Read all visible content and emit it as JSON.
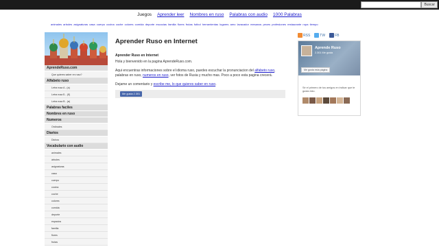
{
  "search": {
    "placeholder": "",
    "button_label": "Buscar"
  },
  "nav": {
    "items": [
      {
        "label": "Juegos",
        "link": false
      },
      {
        "label": "Aprender leer",
        "link": true
      },
      {
        "label": "Nombres en ruso",
        "link": true
      },
      {
        "label": "Palabras con audio",
        "link": true
      },
      {
        "label": "1000 Palabras",
        "link": true
      }
    ]
  },
  "categories": [
    "animales",
    "arboles",
    "asignaturas",
    "casa",
    "cuerpo",
    "cocina",
    "coche",
    "colores",
    "comida",
    "deporte",
    "escocias",
    "familia",
    "flores",
    "frutas",
    "futbol",
    "herramientas",
    "lugares",
    "aero",
    "lavacador",
    "mesanos",
    "peces",
    "profesiones",
    "restaurante",
    "ropa",
    "tiempo"
  ],
  "sidebar": {
    "items": [
      {
        "type": "head",
        "label": "AprendeRuso.com"
      },
      {
        "type": "sub",
        "label": "Que quieres saber en ruso?"
      },
      {
        "type": "head",
        "label": "Alfabeto ruso"
      },
      {
        "type": "sub",
        "label": "Letra rusa A - (a)"
      },
      {
        "type": "sub",
        "label": "Letra rusa Б - (б)"
      },
      {
        "type": "sub",
        "label": "Letra rusa В - (в)"
      },
      {
        "type": "head",
        "label": "Palabras faciles"
      },
      {
        "type": "head",
        "label": "Nombres en ruso"
      },
      {
        "type": "head",
        "label": "Numeros"
      },
      {
        "type": "sub",
        "label": "Ordinales"
      },
      {
        "type": "head",
        "label": "Diarios"
      },
      {
        "type": "sub",
        "label": "Dichos"
      },
      {
        "type": "head",
        "label": "Vocabulario con audio"
      },
      {
        "type": "sub",
        "label": "animales"
      },
      {
        "type": "sub",
        "label": "árboles"
      },
      {
        "type": "sub",
        "label": "asignaturas"
      },
      {
        "type": "sub",
        "label": "casa"
      },
      {
        "type": "sub",
        "label": "cuerpo"
      },
      {
        "type": "sub",
        "label": "cocina"
      },
      {
        "type": "sub",
        "label": "coche"
      },
      {
        "type": "sub",
        "label": "colores"
      },
      {
        "type": "sub",
        "label": "comida"
      },
      {
        "type": "sub",
        "label": "deporte"
      },
      {
        "type": "sub",
        "label": "espacios"
      },
      {
        "type": "sub",
        "label": "familia"
      },
      {
        "type": "sub",
        "label": "flores"
      },
      {
        "type": "sub",
        "label": "frutas"
      }
    ]
  },
  "main": {
    "title": "Aprender Ruso en Internet",
    "subtitle": "Aprender Ruso en Internet",
    "greeting": "Hola y bienvenido en la pagina AprendeRuso.com.",
    "para2_a": "Aqui encuentras informaciones sobre el idioma ruso, puedes escuchar la pronunciacion del ",
    "para2_link1": "alfabeto ruso",
    "para2_b": ", palabras en ruso, ",
    "para2_link2": "numeros en ruso",
    "para2_c": ", ver fotos de Rusia y mucho mas. Poco a poco esta pagina crecerá.",
    "para3_a": "Dejame un comentario y ",
    "para3_link": "escribe me, lo que quieres saber en ruso",
    "para3_b": ".",
    "like_button": "Me gusta 2.301"
  },
  "right": {
    "social": [
      {
        "label": "RSS",
        "color": "#f18b33"
      },
      {
        "label": "TW",
        "color": "#55acee"
      },
      {
        "label": "FB",
        "color": "#3b5998"
      }
    ],
    "fb": {
      "name": "Aprende Ruso",
      "count": "2.301 Me gusta",
      "like_label": "Me gusta esta página",
      "friends_text": "Sé el primero de tus amigos en indicar que te gusta esto."
    }
  },
  "colors": {
    "link": "#1a1acb",
    "topbar": "#1b1b1b",
    "fb_blue": "#4867aa"
  }
}
